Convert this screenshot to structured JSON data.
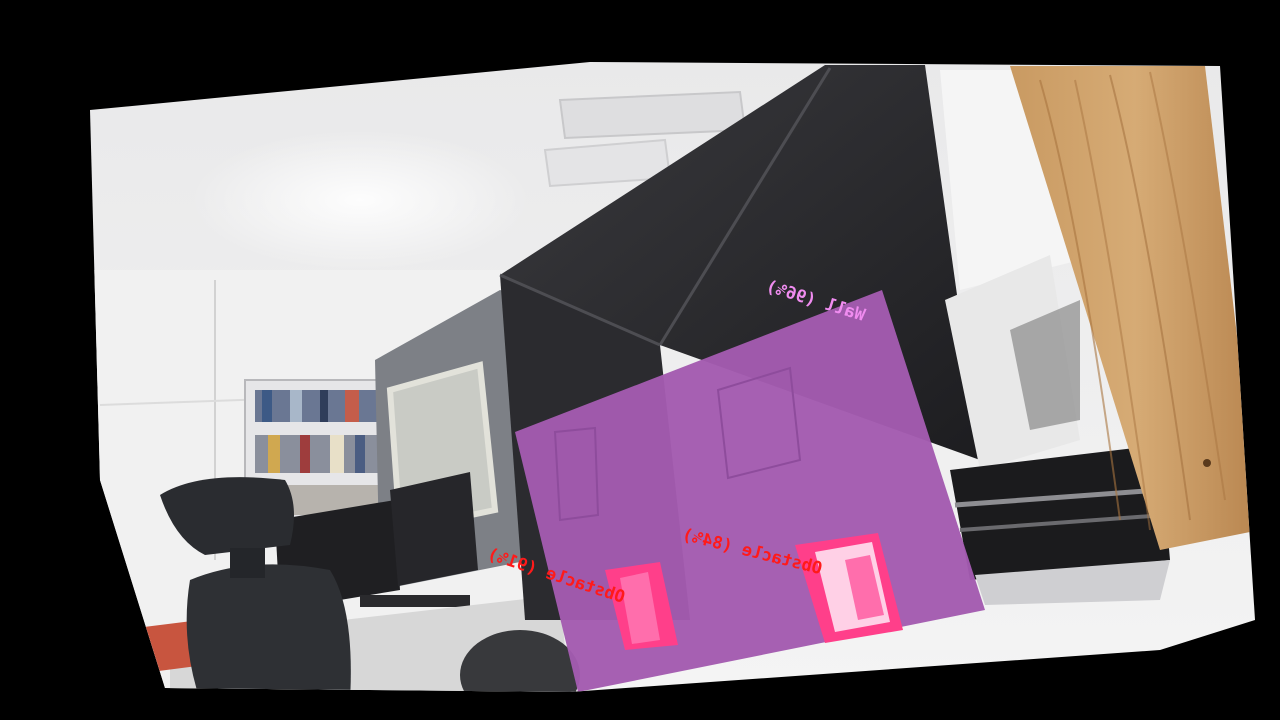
{
  "detections": [
    {
      "label": "Wall (96%)",
      "color": "#f08cf0",
      "class": "wall",
      "confidence": 96
    },
    {
      "label": "Obstacle (84%)",
      "color": "#ff1a1a",
      "class": "obstacle",
      "confidence": 84
    },
    {
      "label": "Obstacle (91%)",
      "color": "#ff1a1a",
      "class": "obstacle",
      "confidence": 91
    }
  ],
  "colors": {
    "wall_mask": "#a35bb0",
    "obstacle_mask": "#ff3f8a",
    "background": "#000000"
  }
}
